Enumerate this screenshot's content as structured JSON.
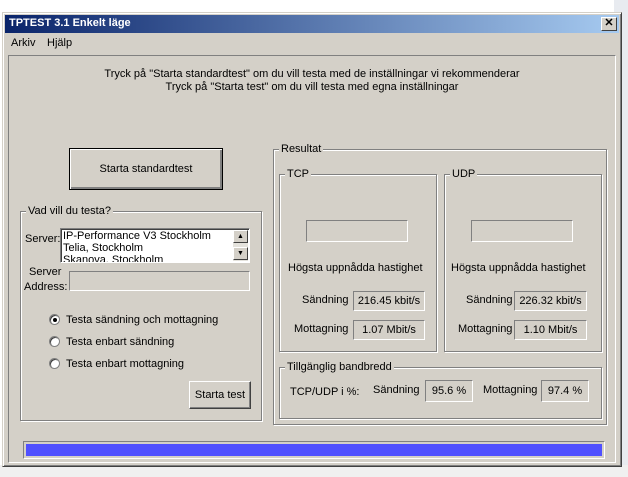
{
  "window": {
    "title": "TPTEST 3.1 Enkelt läge",
    "close_label": "✕"
  },
  "menu": [
    "Arkiv",
    "Hjälp"
  ],
  "instructions": [
    "Tryck på \"Starta standardtest\" om du vill testa med de inställningar vi rekommenderar",
    "Tryck på \"Starta test\" om du vill testa med egna inställningar"
  ],
  "buttons": {
    "standard_test": "Starta standardtest",
    "start_test": "Starta test"
  },
  "test_group": {
    "title": "Vad vill du testa?",
    "server_label": "Server:",
    "servers": [
      "IP-Performance V3 Stockholm",
      "Telia, Stockholm",
      "Skanova, Stockholm"
    ],
    "address_label_1": "Server",
    "address_label_2": "Address:",
    "address_value": "",
    "options": [
      {
        "label": "Testa sändning och mottagning",
        "selected": true
      },
      {
        "label": "Testa enbart sändning",
        "selected": false
      },
      {
        "label": "Testa enbart mottagning",
        "selected": false
      }
    ]
  },
  "results": {
    "title": "Resultat",
    "tcp": {
      "title": "TCP",
      "top_value": "",
      "top_label": "Högsta uppnådda hastighet",
      "send_label": "Sändning",
      "send_value": "216.45 kbit/s",
      "recv_label": "Mottagning",
      "recv_value": "1.07 Mbit/s"
    },
    "udp": {
      "title": "UDP",
      "top_value": "",
      "top_label": "Högsta uppnådda hastighet",
      "send_label": "Sändning",
      "send_value": "226.32 kbit/s",
      "recv_label": "Mottagning",
      "recv_value": "1.10 Mbit/s"
    },
    "bandwidth": {
      "title": "Tillgänglig bandbredd",
      "row_label": "TCP/UDP i %:",
      "send_label": "Sändning",
      "send_value": "95.6 %",
      "recv_label": "Mottagning",
      "recv_value": "97.4 %"
    }
  },
  "progress": {
    "fraction": 1.0
  },
  "colors": {
    "title_start": "#0a246a",
    "title_end": "#a6caf0",
    "face": "#d4d0c8",
    "progress": "#5050ff"
  }
}
